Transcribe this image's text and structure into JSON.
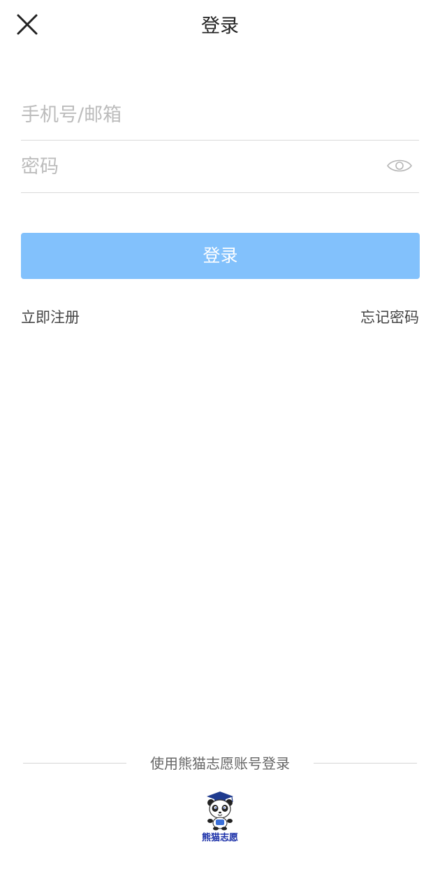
{
  "header": {
    "title": "登录",
    "close_icon": "close-icon"
  },
  "form": {
    "account_placeholder": "手机号/邮箱",
    "account_value": "",
    "password_placeholder": "密码",
    "password_value": "",
    "visibility_icon": "eye-icon",
    "login_label": "登录"
  },
  "links": {
    "register": "立即注册",
    "forgot": "忘记密码"
  },
  "third_party": {
    "divider_text": "使用熊猫志愿账号登录",
    "panda_label": "熊猫志愿"
  },
  "colors": {
    "login_button": "#82c1fc",
    "panda_brand": "#1a2fa8"
  }
}
